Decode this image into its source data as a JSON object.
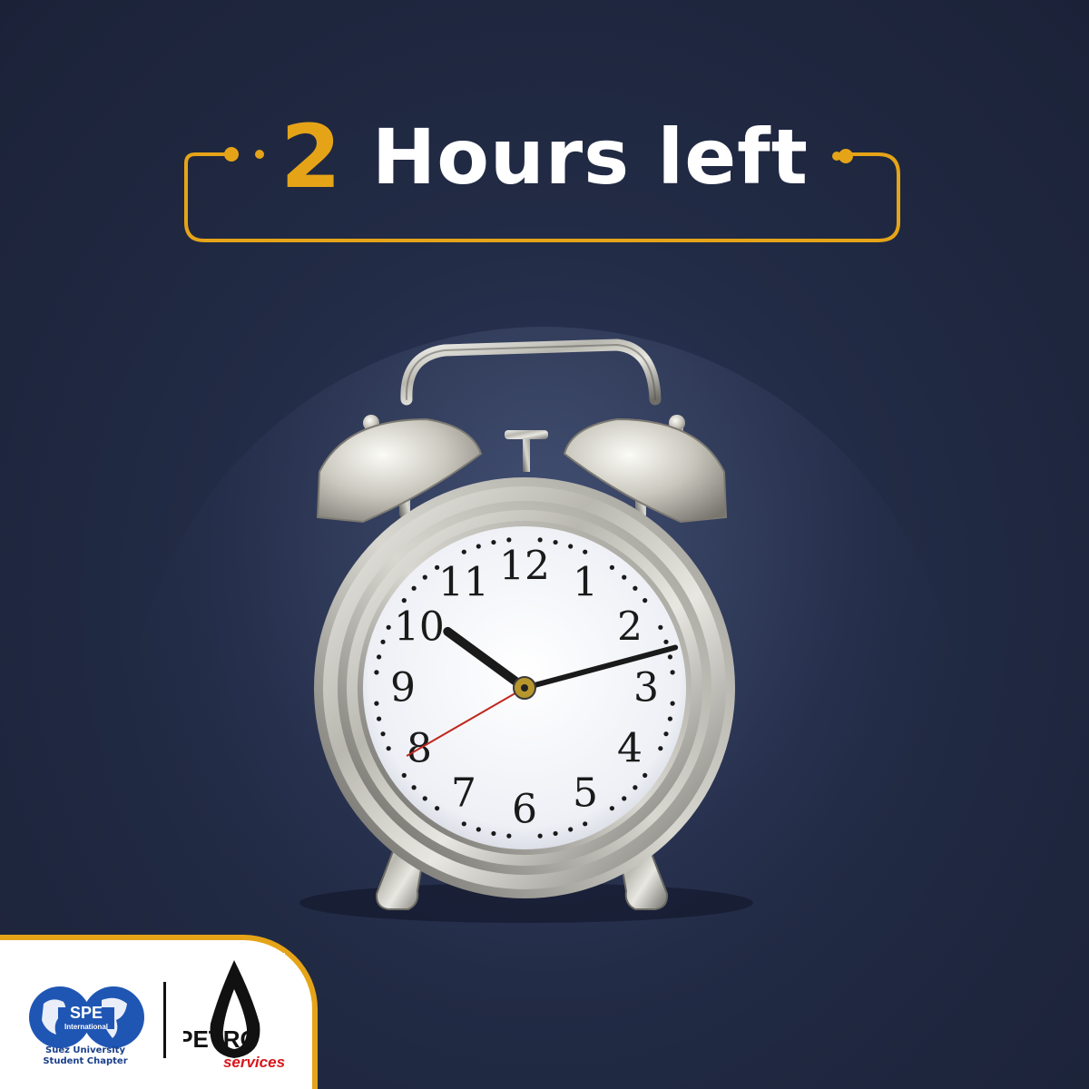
{
  "title": {
    "number": "2",
    "text": "Hours left"
  },
  "clock": {
    "numerals": [
      "12",
      "1",
      "2",
      "3",
      "4",
      "5",
      "6",
      "7",
      "8",
      "9",
      "10",
      "11"
    ],
    "time": {
      "hour": 10,
      "minute": 12.5,
      "second": 40
    }
  },
  "footer": {
    "spe_logo_text": "SPE",
    "spe_logo_subtext": "International",
    "spe_caption_line1": "Suez University",
    "spe_caption_line2": "Student Chapter",
    "petro_logo_text": "PETRO",
    "petro_logo_subtext": "services"
  },
  "colors": {
    "background": "#222b45",
    "accent": "#e5a418",
    "title_text": "#ffffff",
    "second_hand": "#c0281f",
    "logo_red": "#d9161c",
    "logo_blue": "#1f56b4"
  }
}
